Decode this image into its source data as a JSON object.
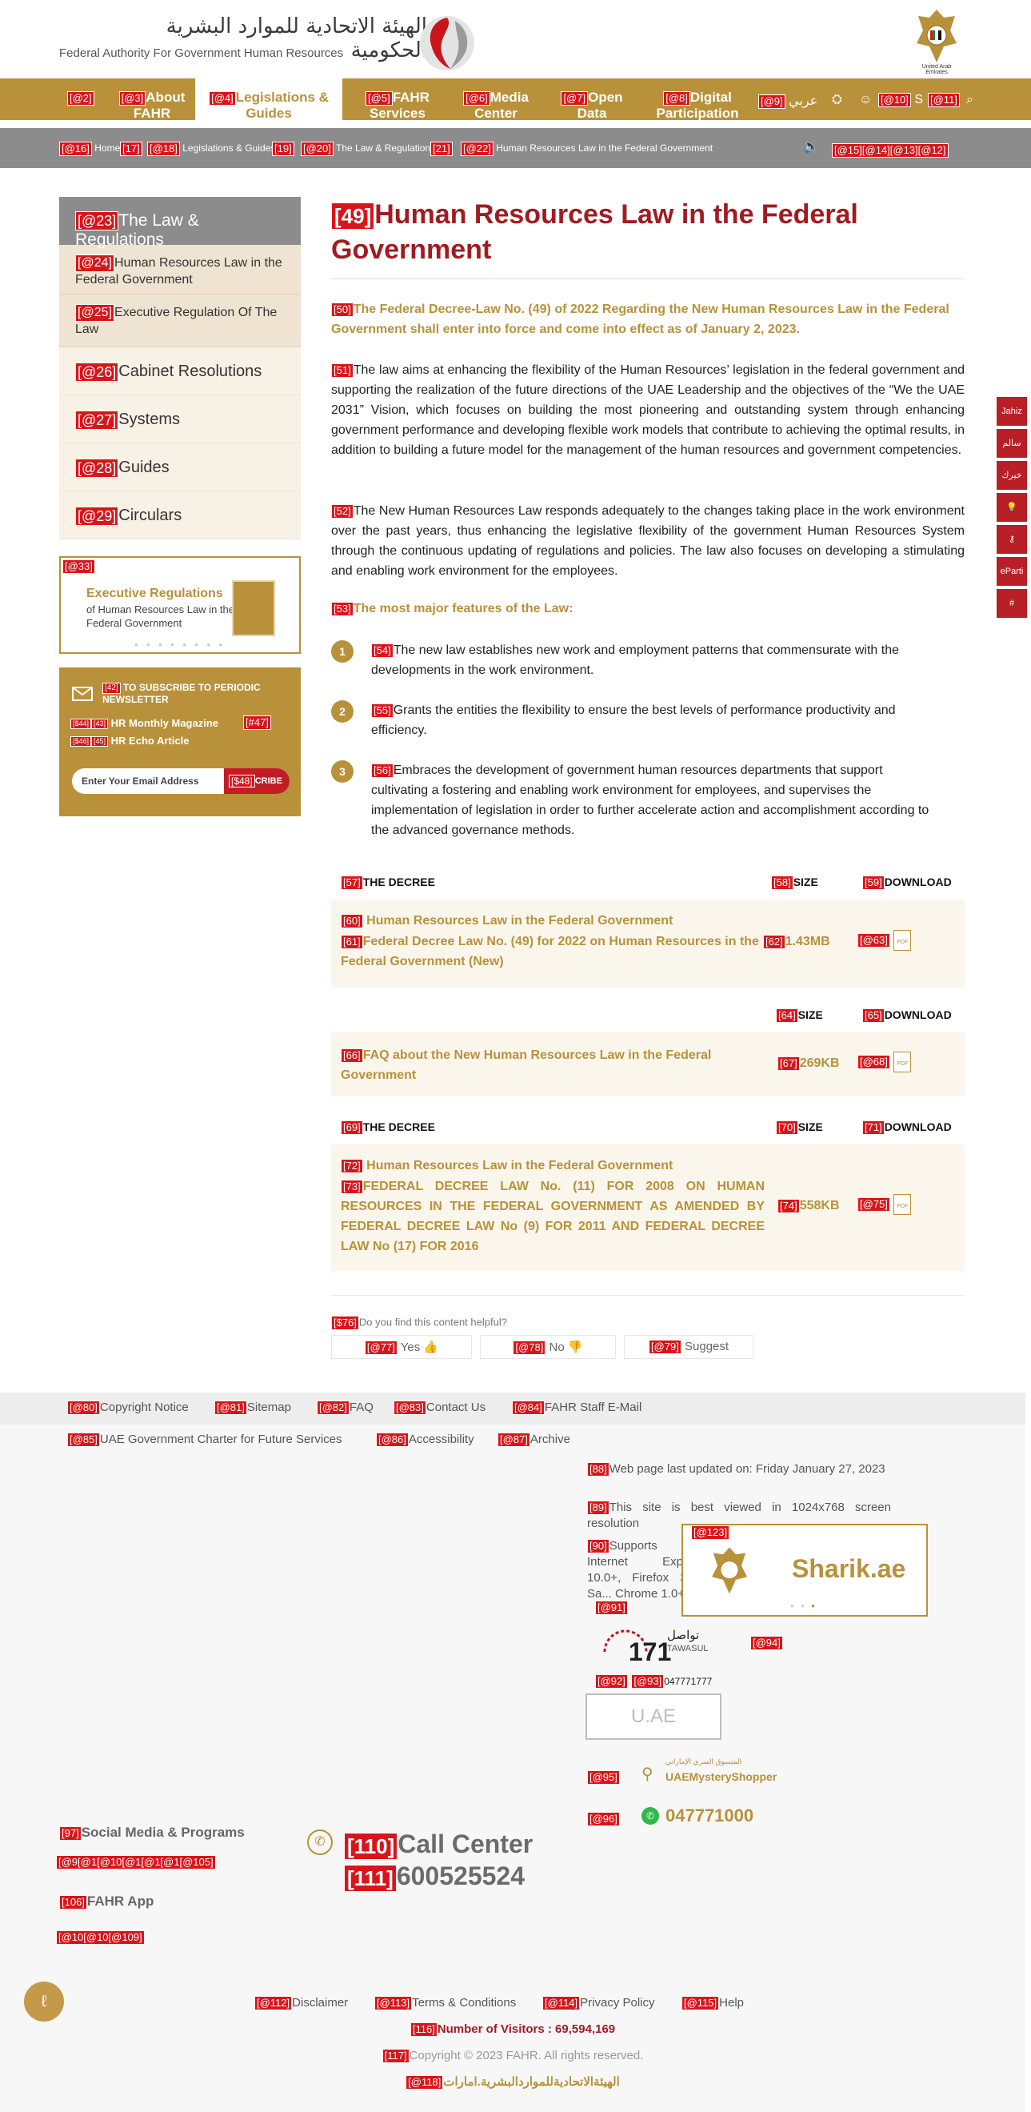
{
  "header": {
    "logo_arabic": "الهيئة الاتحادية للموارد البشرية الحكومية",
    "logo_english": "Federal Authority For Government Human Resources",
    "emblem_caption": "United Arab Emirates"
  },
  "nav": {
    "items": [
      {
        "tag": "[@2]",
        "label": ""
      },
      {
        "tag": "[@3]",
        "label": "About FAHR"
      },
      {
        "tag": "[@4]",
        "label": "Legislations & Guides"
      },
      {
        "tag": "[@5]",
        "label": "FAHR Services"
      },
      {
        "tag": "[@6]",
        "label": "Media Center"
      },
      {
        "tag": "[@7]",
        "label": "Open Data"
      },
      {
        "tag": "[@8]",
        "label": "Digital Participation"
      }
    ],
    "lang_tag": "[@9]",
    "lang_label": "عربي",
    "tag10": "[@10]",
    "tag11": "[@11]",
    "s_letter": "S"
  },
  "breadcrumb": {
    "items": [
      {
        "tag": "[@16]",
        "label": "Home"
      },
      {
        "tag": "[17]",
        "label": ""
      },
      {
        "tag": "[@18]",
        "label": "Legislations & Guides"
      },
      {
        "tag": "[19]",
        "label": ""
      },
      {
        "tag": "[@20]",
        "label": "The Law & Regulations"
      },
      {
        "tag": "[21]",
        "label": ""
      },
      {
        "tag": "[@22]",
        "label": "Human Resources Law in the Federal Government"
      }
    ],
    "tools_tags": "[@15][@14][@13][@12]"
  },
  "sidebar": {
    "head_tag": "[@23]",
    "head": "The Law & Regulations",
    "subs": [
      {
        "tag": "[@24]",
        "label": "Human Resources Law in the Federal Government"
      },
      {
        "tag": "[@25]",
        "label": "Executive Regulation Of The Law"
      }
    ],
    "items": [
      {
        "tag": "[@26]",
        "label": "Cabinet Resolutions"
      },
      {
        "tag": "[@27]",
        "label": "Systems"
      },
      {
        "tag": "[@28]",
        "label": "Guides"
      },
      {
        "tag": "[@29]",
        "label": "Circulars"
      }
    ],
    "promo": {
      "tag": "[@33]",
      "title": "Executive Regulations",
      "subtitle": "of Human Resources Law in the Federal Government"
    },
    "newsletter": {
      "tag42": "[42]",
      "title": "TO SUBSCRIBE TO PERIODIC NEWSLETTER",
      "item1_tag": "[$44]",
      "item1_tag2": "[43]",
      "item1": "HR Monthly Magazine",
      "item2_tag": "[$46]",
      "item2_tag2": "[45]",
      "item2": "HR Echo Article",
      "tag47": "[#47]",
      "placeholder": "Enter Your Email Address",
      "button_tag": "[$48]",
      "button": "CRIBE"
    }
  },
  "main": {
    "title_tag": "[49]",
    "title": "Human Resources Law in the Federal Government",
    "lead_tag": "[50]",
    "lead": "The Federal Decree-Law No. (49) of 2022 Regarding the New Human Resources Law in the Federal Government shall enter into force and come into effect as of January 2, 2023.",
    "p1_tag": "[51]",
    "p1": "The law aims at enhancing the flexibility of the Human Resources’ legislation in the federal government and supporting the realization of the future directions of the UAE Leadership and the objectives of the “We the UAE 2031” Vision, which focuses on building the most pioneering and outstanding system through enhancing government performance and developing flexible work models that contribute to achieving the optimal results, in addition to building a future model for the management of the human resources and government competencies.",
    "p2_tag": "[52]",
    "p2": "The New Human Resources Law responds adequately to the changes taking place in the work environment over the past years, thus enhancing the legislative flexibility of the government Human Resources System through the continuous updating of regulations and policies. The law also focuses on developing a stimulating and enabling work environment for the employees.",
    "features_tag": "[53]",
    "features_head": "The most major features of the Law:",
    "features": [
      {
        "num": "1",
        "tag": "[54]",
        "text": "The new law establishes new work and employment patterns that commensurate with the developments in the work environment."
      },
      {
        "num": "2",
        "tag": "[55]",
        "text": "Grants the entities the flexibility to ensure the best levels of performance productivity and efficiency."
      },
      {
        "num": "3",
        "tag": "[56]",
        "text": "Embraces the development of government human resources departments that support cultivating a fostering and enabling work environment for employees, and supervises the implementation of legislation in order to further accelerate action and accomplishment according to the advanced governance methods."
      }
    ],
    "table1": {
      "h1_tag": "[57]",
      "h1": "THE DECREE",
      "h2_tag": "[58]",
      "h2": "SIZE",
      "h3_tag": "[59]",
      "h3": "DOWNLOAD",
      "t1_tag": "[60]",
      "t1": "Human Resources Law in the Federal Government",
      "t2_tag": "[61]",
      "t2": "Federal Decree Law No. (49) for 2022 on Human Resources in the Federal Government (New)",
      "size_tag": "[62]",
      "size": "1.43MB",
      "dl_tag": "[@63]"
    },
    "table2": {
      "h2_tag": "[64]",
      "h2": "SIZE",
      "h3_tag": "[65]",
      "h3": "DOWNLOAD",
      "t_tag": "[66]",
      "t": "FAQ about the New Human Resources Law in the Federal Government",
      "size_tag": "[67]",
      "size": "269KB",
      "dl_tag": "[@68]"
    },
    "table3": {
      "h1_tag": "[69]",
      "h1": "THE DECREE",
      "h2_tag": "[70]",
      "h2": "SIZE",
      "h3_tag": "[71]",
      "h3": "DOWNLOAD",
      "t1_tag": "[72]",
      "t1": "Human Resources Law in the Federal Government",
      "t2_tag": "[73]",
      "t2": "FEDERAL DECREE LAW No. (11) FOR 2008 ON HUMAN RESOURCES IN THE FEDERAL GOVERNMENT AS AMENDED BY FEDERAL DECREE LAW No (9) FOR 2011 AND FEDERAL DECREE LAW No (17) FOR 2016",
      "size_tag": "[74]",
      "size": "558KB",
      "dl_tag": "[@75]"
    },
    "pdf_label": "PDF",
    "feedback": {
      "q_tag": "[$76]",
      "question": "Do you find this content helpful?",
      "yes_tag": "[@77]",
      "yes": "Yes",
      "no_tag": "[@78]",
      "no": "No",
      "suggest_tag": "[@79]",
      "suggest": "Suggest"
    }
  },
  "edge_icons": [
    "Jahiz",
    "سالم",
    "خيرك",
    "idea",
    "key",
    "eParti",
    "#"
  ],
  "footer": {
    "links1": [
      {
        "tag": "[@80]",
        "label": "Copyright Notice"
      },
      {
        "tag": "[@81]",
        "label": "Sitemap"
      },
      {
        "tag": "[@82]",
        "label": "FAQ"
      },
      {
        "tag": "[@83]",
        "label": "Contact Us"
      },
      {
        "tag": "[@84]",
        "label": "FAHR Staff E-Mail"
      }
    ],
    "links2": [
      {
        "tag": "[@85]",
        "label": "UAE Government Charter for Future Services"
      },
      {
        "tag": "[@86]",
        "label": "Accessibility"
      },
      {
        "tag": "[@87]",
        "label": "Archive"
      }
    ],
    "info": [
      {
        "tag": "[88]",
        "text": "Web page last updated on: Friday January 27, 2023"
      },
      {
        "tag": "[89]",
        "text": "This site is best viewed in 1024x768 screen resolution"
      },
      {
        "tag": "[90]",
        "text": "Supports Mi... Internet Explorer 10.0+, Firefox 3.0+, Sa... Chrome 1.0+"
      }
    ],
    "sharik_tag": "[@123]",
    "sharik": "Sharik.ae",
    "tag91": "[@91]",
    "tawasul_ar": "تواصل",
    "tawasul_en": "TAWASUL",
    "tawasul_num": "171",
    "tag92": "[@92]",
    "tag93": "[@93]",
    "phone_small": "047771777",
    "tag94": "[@94]",
    "uae_tag": "",
    "uae_label": "U.AE",
    "tag95": "[@95]",
    "mystery_ar": "المتسوق السري الإماراتي",
    "mystery": "UAEMysteryShopper",
    "tag96": "[@96]",
    "whatsapp": "047771000",
    "social_tag": "[97]",
    "social": "Social Media & Programs",
    "social_tags": "[@9[@1[@10[@1[@1[@1[@105]",
    "app_tag": "[106]",
    "app": "FAHR App",
    "app_tags": "[@10[@10[@109]",
    "call_tag": "[110]",
    "call": "Call Center",
    "callnum_tag": "[111]",
    "callnum": "600525524",
    "bottom": [
      {
        "tag": "[@112]",
        "label": "Disclaimer"
      },
      {
        "tag": "[@113]",
        "label": "Terms & Conditions"
      },
      {
        "tag": "[@114]",
        "label": "Privacy Policy"
      },
      {
        "tag": "[@115]",
        "label": "Help"
      }
    ],
    "visitors_tag": "[116]",
    "visitors": "Number of Visitors : 69,594,169",
    "copyright_tag": "[117]",
    "copyright": "Copyright © 2023 FAHR. All rights reserved.",
    "ae_tag": "[@118]",
    "ae": "الهيئةالاتحاديةللمواردالبشرية.امارات"
  },
  "colors": {
    "gold": "#b8913a",
    "red": "#a01c22",
    "gray": "#8c8c8c"
  }
}
